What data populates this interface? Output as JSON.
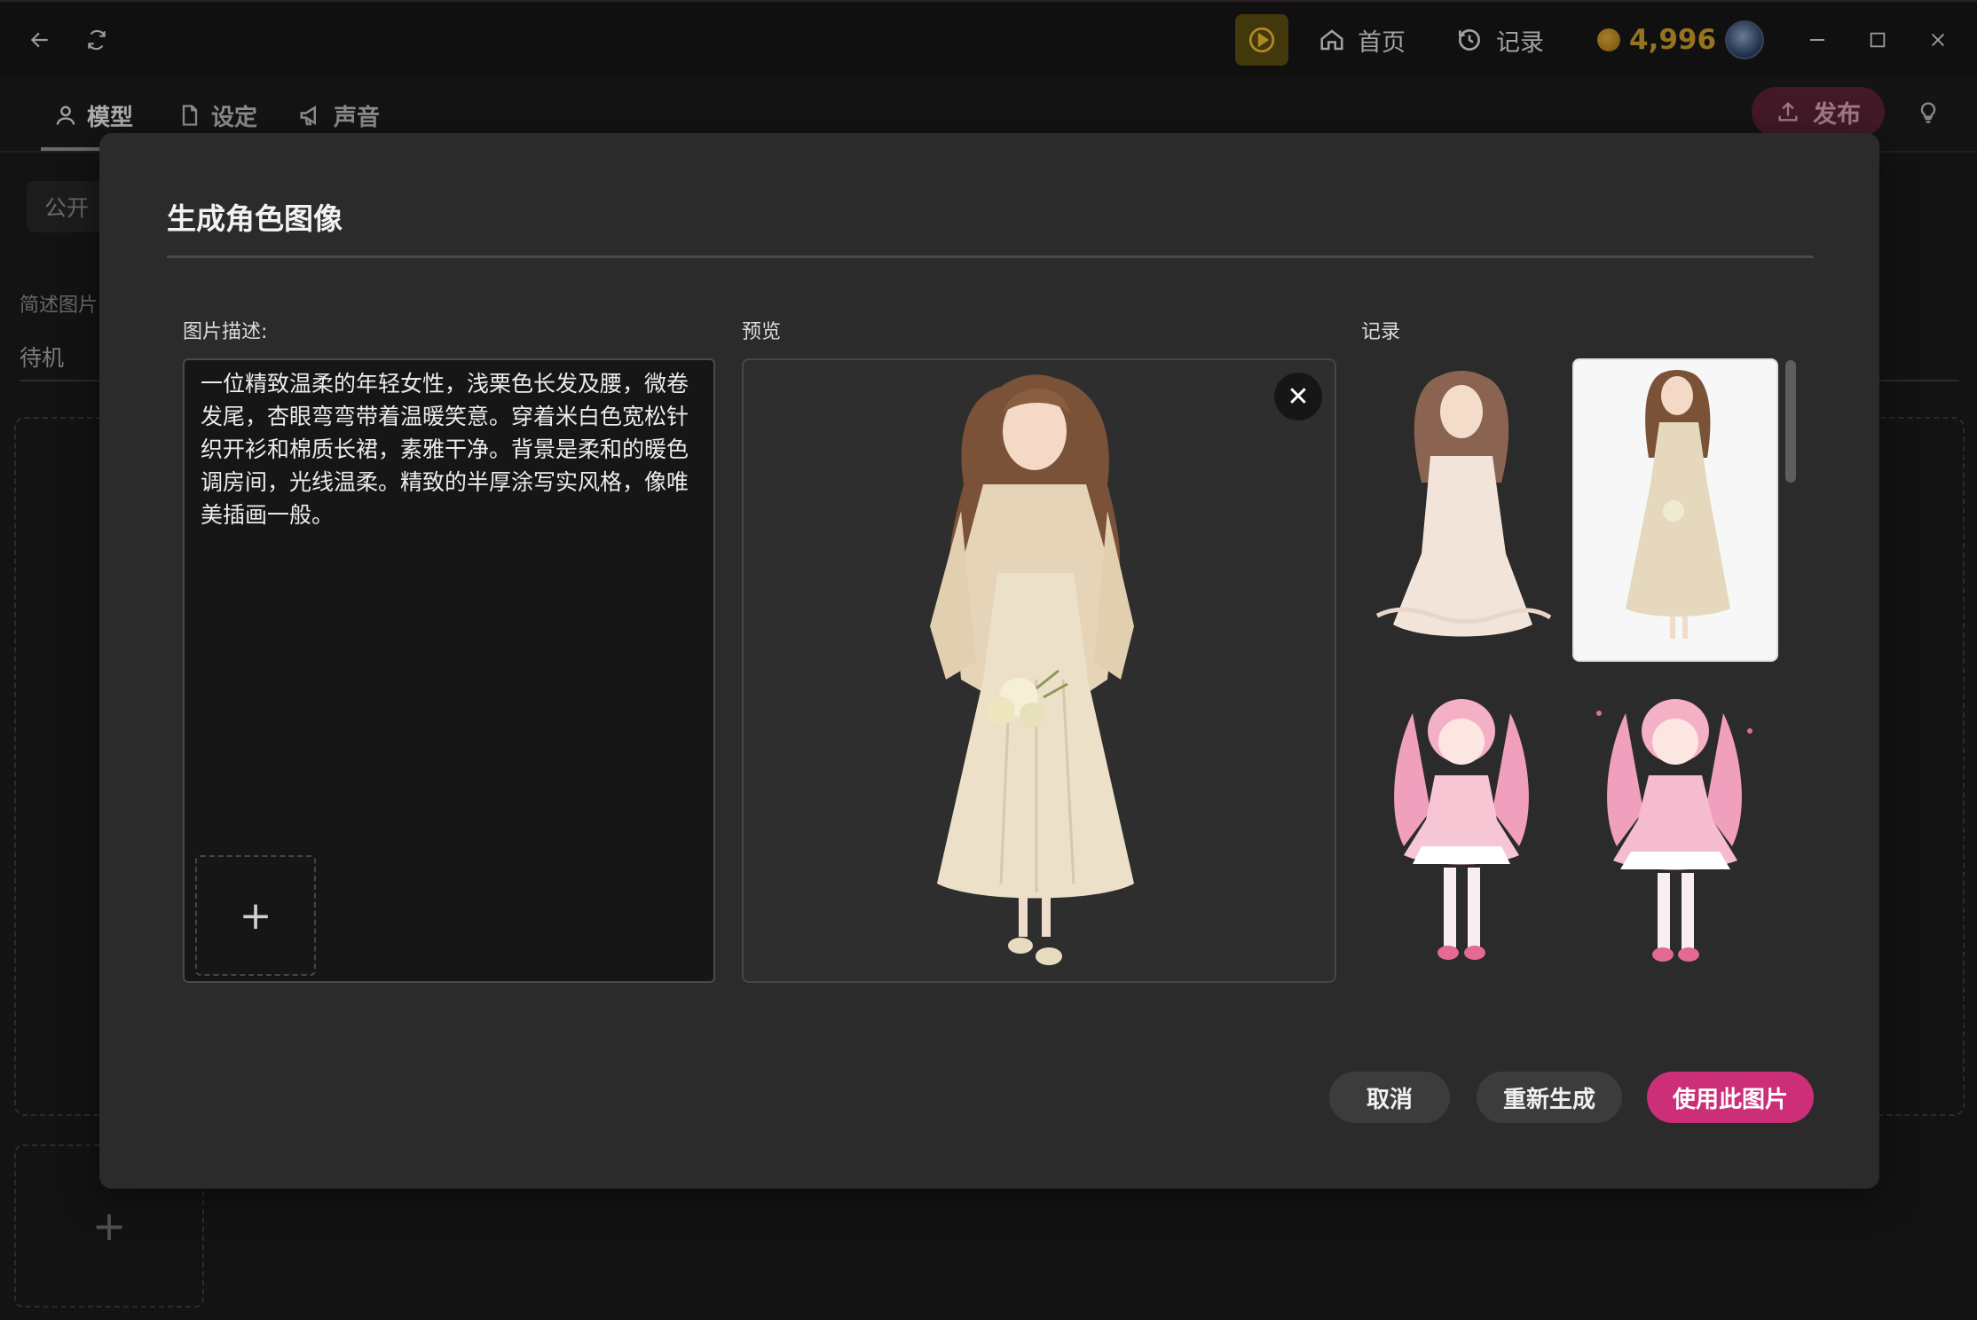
{
  "titlebar": {
    "nav_home": "首页",
    "nav_history": "记录",
    "coins": "4,996"
  },
  "tabs": [
    {
      "label": "模型",
      "icon": "user-icon",
      "active": true
    },
    {
      "label": "设定",
      "icon": "document-icon",
      "active": false
    },
    {
      "label": "声音",
      "icon": "megaphone-icon",
      "active": false
    }
  ],
  "publish_label": "发布",
  "background": {
    "visibility_chip": "公开",
    "field_label": "简述图片",
    "status": "待机"
  },
  "modal": {
    "title": "生成角色图像",
    "description_label": "图片描述:",
    "description_text": "一位精致温柔的年轻女性，浅栗色长发及腰，微卷发尾，杏眼弯弯带着温暖笑意。穿着米白色宽松针织开衫和棉质长裙，素雅干净。背景是柔和的暖色调房间，光线温柔。精致的半厚涂写实风格，像唯美插画一般。",
    "preview_label": "预览",
    "history_label": "记录",
    "history_selected_index": 1,
    "buttons": {
      "cancel": "取消",
      "regenerate": "重新生成",
      "use_image": "使用此图片"
    }
  },
  "colors": {
    "accent_pink": "#cd2e78",
    "coin_gold": "#c99a2a",
    "modal_bg": "#2b2b2b"
  }
}
